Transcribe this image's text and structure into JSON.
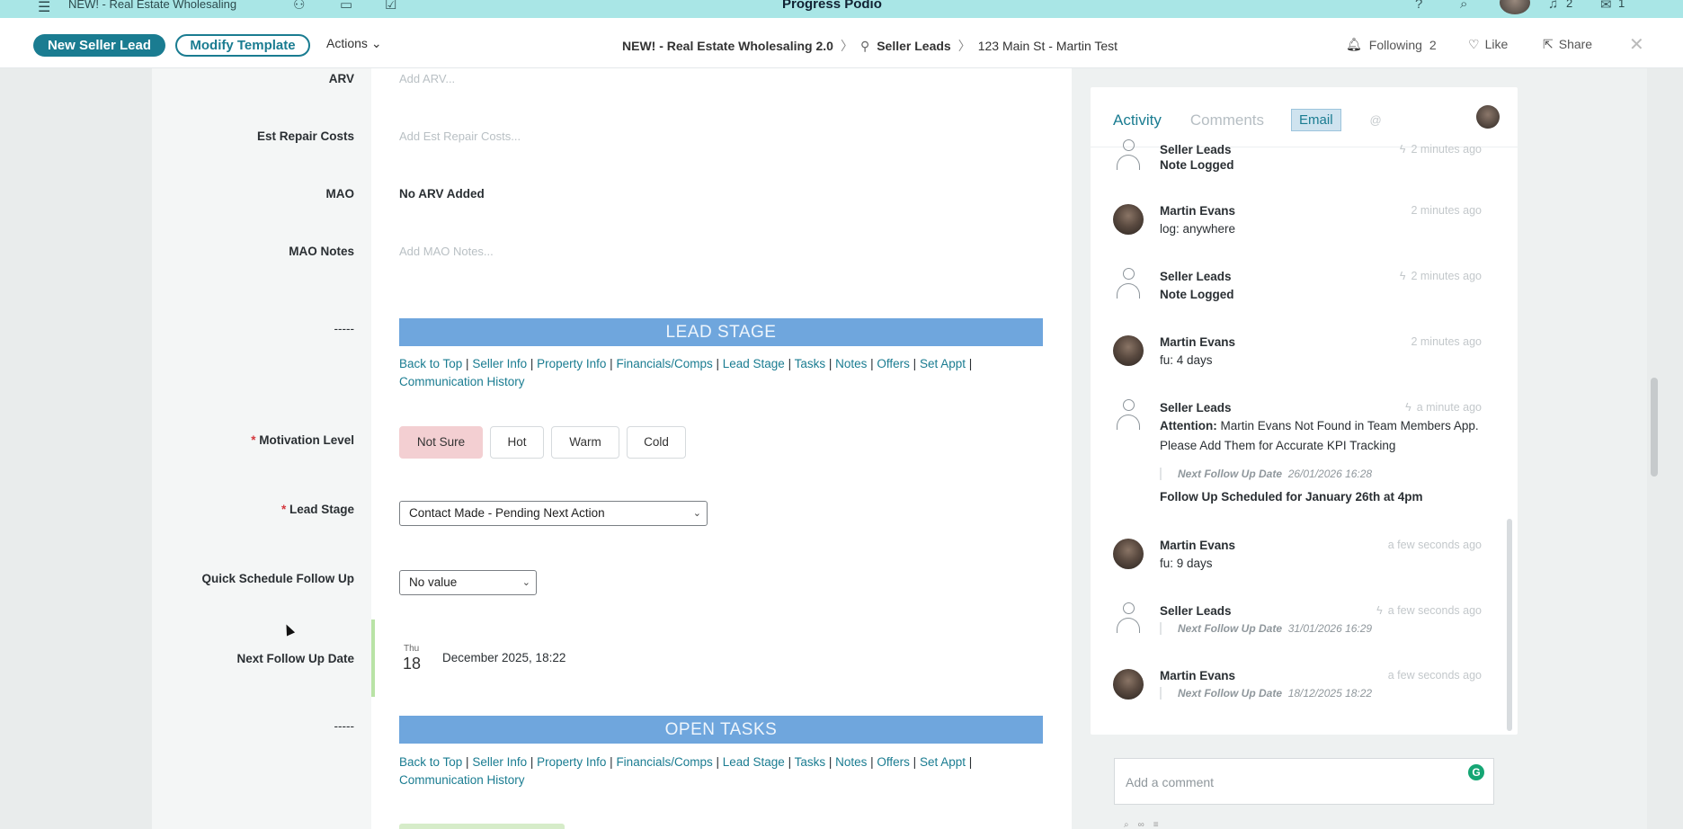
{
  "topbar": {
    "workspace": "NEW! - Real Estate Wholesaling",
    "logo": "Progress Podio",
    "notifications_count": "2",
    "messages_count": "1"
  },
  "actionbar": {
    "new_button": "New Seller Lead",
    "modify_button": "Modify Template",
    "actions_label": "Actions",
    "breadcrumb": {
      "workspace": "NEW! - Real Estate Wholesaling 2.0",
      "app": "Seller Leads",
      "item": "123 Main St - Martin Test"
    },
    "following_label": "Following",
    "following_count": "2",
    "like_label": "Like",
    "share_label": "Share"
  },
  "fields": {
    "arv": {
      "label": "ARV",
      "placeholder": "Add ARV..."
    },
    "repair": {
      "label": "Est Repair Costs",
      "placeholder": "Add Est Repair Costs..."
    },
    "mao": {
      "label": "MAO",
      "value": "No ARV Added"
    },
    "mao_notes": {
      "label": "MAO Notes",
      "placeholder": "Add MAO Notes..."
    },
    "divider_label": "-----",
    "motivation": {
      "label": "Motivation Level",
      "options": [
        "Not Sure",
        "Hot",
        "Warm",
        "Cold"
      ],
      "selected": "Not Sure"
    },
    "lead_stage": {
      "label": "Lead Stage",
      "value": "Contact Made - Pending Next Action"
    },
    "quick_schedule": {
      "label": "Quick Schedule Follow Up",
      "value": "No value"
    },
    "next_follow_up": {
      "label": "Next Follow Up Date",
      "weekday": "Thu",
      "day": "18",
      "rest": "December 2025, 18:22"
    }
  },
  "sections": {
    "lead_stage_banner": "LEAD STAGE",
    "open_tasks_banner": "OPEN TASKS",
    "nav_links": [
      "Back to Top",
      "Seller Info",
      "Property Info",
      "Financials/Comps",
      "Lead Stage",
      "Tasks",
      "Notes",
      "Offers",
      "Set Appt",
      "Communication History"
    ]
  },
  "activity": {
    "tabs": {
      "activity": "Activity",
      "comments": "Comments",
      "email": "Email",
      "at": "@"
    },
    "items": [
      {
        "who": "Seller Leads",
        "when": "2 minutes ago",
        "msg": "Note Logged"
      },
      {
        "who": "Martin Evans",
        "when": "2 minutes ago",
        "msg": "log: anywhere"
      },
      {
        "who": "Seller Leads",
        "when": "2 minutes ago",
        "msg": "Note Logged"
      },
      {
        "who": "Martin Evans",
        "when": "2 minutes ago",
        "msg": "fu: 4 days"
      },
      {
        "who": "Seller Leads",
        "when": "a minute ago",
        "msg_bold": "Attention:",
        "msg": " Martin Evans Not Found in Team Members App. Please Add Them for Accurate KPI Tracking",
        "quote_label": "Next Follow Up Date",
        "quote_value": "26/01/2026 16:28",
        "extra": "Follow Up Scheduled for January 26th at 4pm"
      },
      {
        "who": "Martin Evans",
        "when": "a few seconds ago",
        "msg": "fu: 9 days"
      },
      {
        "who": "Seller Leads",
        "when": "a few seconds ago",
        "quote_label": "Next Follow Up Date",
        "quote_value": "31/01/2026 16:29"
      },
      {
        "who": "Martin Evans",
        "when": "a few seconds ago",
        "quote_label": "Next Follow Up Date",
        "quote_value": "18/12/2025 18:22"
      }
    ],
    "comment_placeholder": "Add a comment"
  }
}
